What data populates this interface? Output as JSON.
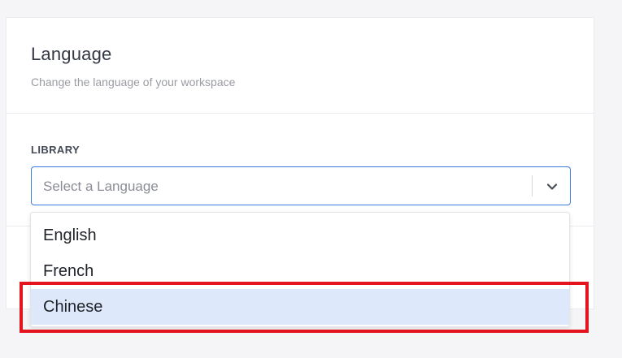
{
  "card": {
    "title": "Language",
    "subtitle": "Change the language of your workspace"
  },
  "field": {
    "label": "LIBRARY",
    "placeholder": "Select a Language"
  },
  "dropdown": {
    "options": [
      {
        "label": "English"
      },
      {
        "label": "French"
      },
      {
        "label": "Chinese"
      }
    ],
    "hovered_index": 2
  },
  "colors": {
    "accent": "#3b7be0",
    "hover_option": "#dde9fb",
    "annotation": "#e3141e"
  },
  "icons": {
    "select_toggle": "chevron-down-icon"
  }
}
